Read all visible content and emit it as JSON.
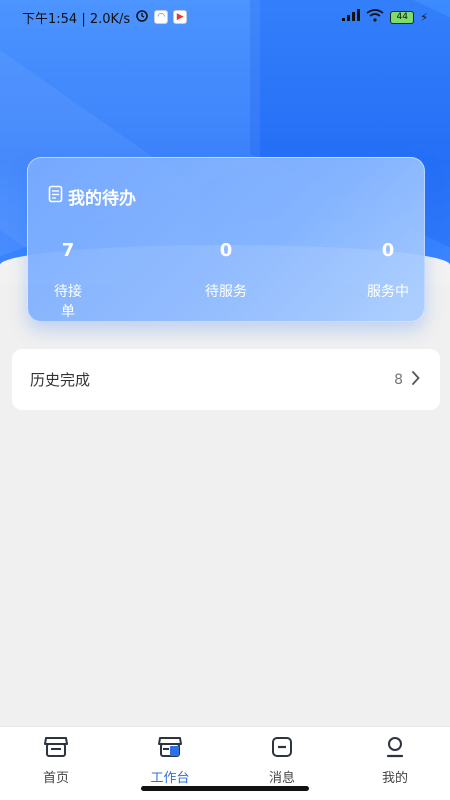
{
  "status_bar": {
    "time_speed": "下午1:54 | 2.0K/s",
    "battery": "44"
  },
  "todo": {
    "title": "我的待办",
    "stats": [
      {
        "value": "7",
        "label": "待接单"
      },
      {
        "value": "0",
        "label": "待服务"
      },
      {
        "value": "0",
        "label": "服务中"
      }
    ]
  },
  "history": {
    "label": "历史完成",
    "count": "8"
  },
  "nav": {
    "items": [
      {
        "label": "首页",
        "icon": "shop-icon"
      },
      {
        "label": "工作台",
        "icon": "workbench-icon"
      },
      {
        "label": "消息",
        "icon": "message-icon"
      },
      {
        "label": "我的",
        "icon": "profile-icon"
      }
    ],
    "active_index": 1
  },
  "colors": {
    "primary": "#2b78fb",
    "active_nav": "#2d6fe6"
  }
}
